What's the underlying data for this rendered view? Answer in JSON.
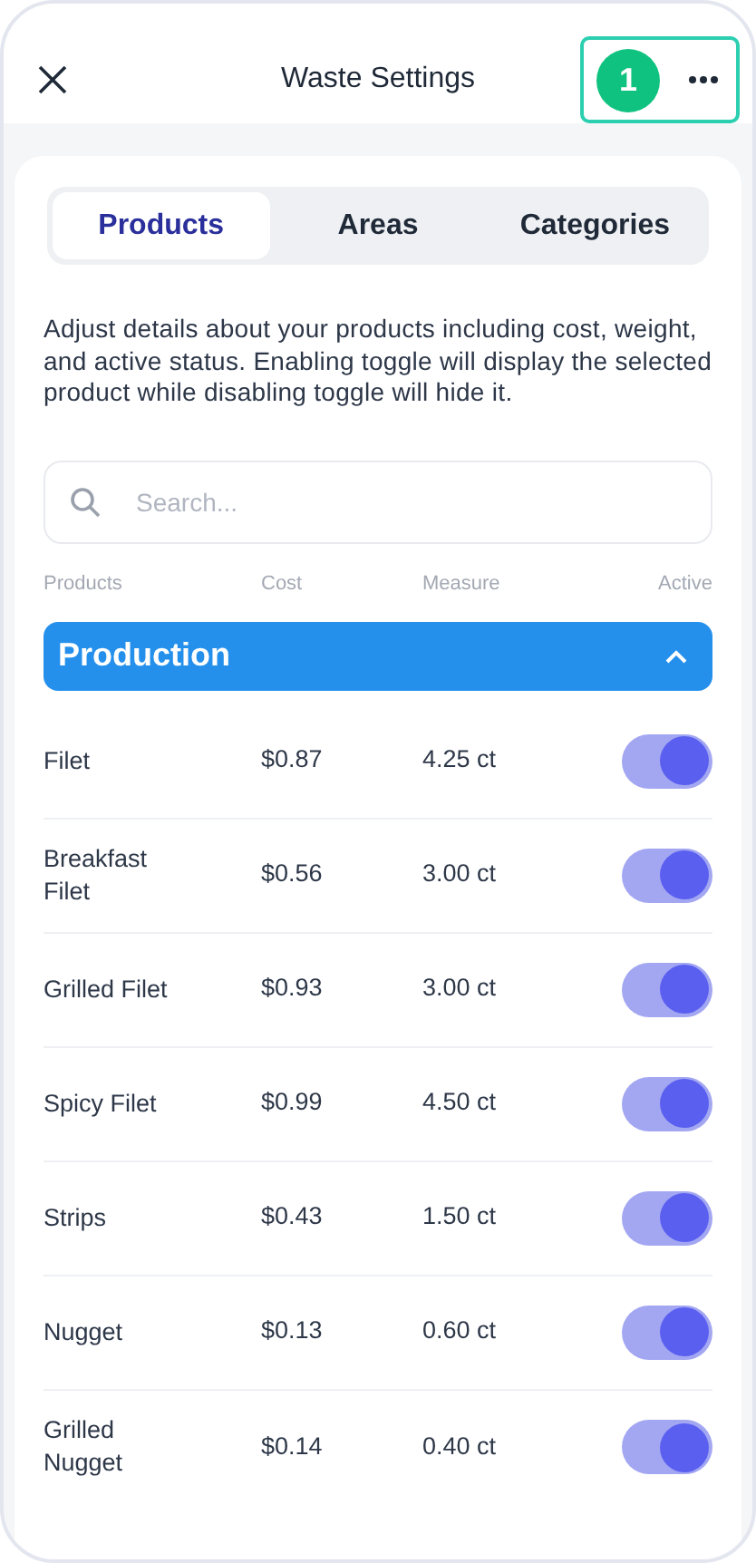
{
  "header": {
    "title": "Waste Settings",
    "badge": "1"
  },
  "tabs": [
    {
      "label": "Products",
      "selected": true
    },
    {
      "label": "Areas",
      "selected": false
    },
    {
      "label": "Categories",
      "selected": false
    }
  ],
  "description": "Adjust details about your products including cost, weight, and active status. Enabling toggle will display the selected product while disabling toggle will hide it.",
  "search": {
    "placeholder": "Search..."
  },
  "columns": [
    "Products",
    "Cost",
    "Measure",
    "Active"
  ],
  "group": {
    "title": "Production",
    "expanded": true
  },
  "rows": [
    {
      "name": "Filet",
      "cost": "$0.87",
      "measure": "4.25 ct",
      "active": true
    },
    {
      "name": "Breakfast Filet",
      "cost": "$0.56",
      "measure": "3.00 ct",
      "active": true
    },
    {
      "name": "Grilled Filet",
      "cost": "$0.93",
      "measure": "3.00 ct",
      "active": true
    },
    {
      "name": "Spicy Filet",
      "cost": "$0.99",
      "measure": "4.50 ct",
      "active": true
    },
    {
      "name": "Strips",
      "cost": "$0.43",
      "measure": "1.50 ct",
      "active": true
    },
    {
      "name": "Nugget",
      "cost": "$0.13",
      "measure": "0.60 ct",
      "active": true
    },
    {
      "name": "Grilled Nugget",
      "cost": "$0.14",
      "measure": "0.40 ct",
      "active": true
    }
  ]
}
